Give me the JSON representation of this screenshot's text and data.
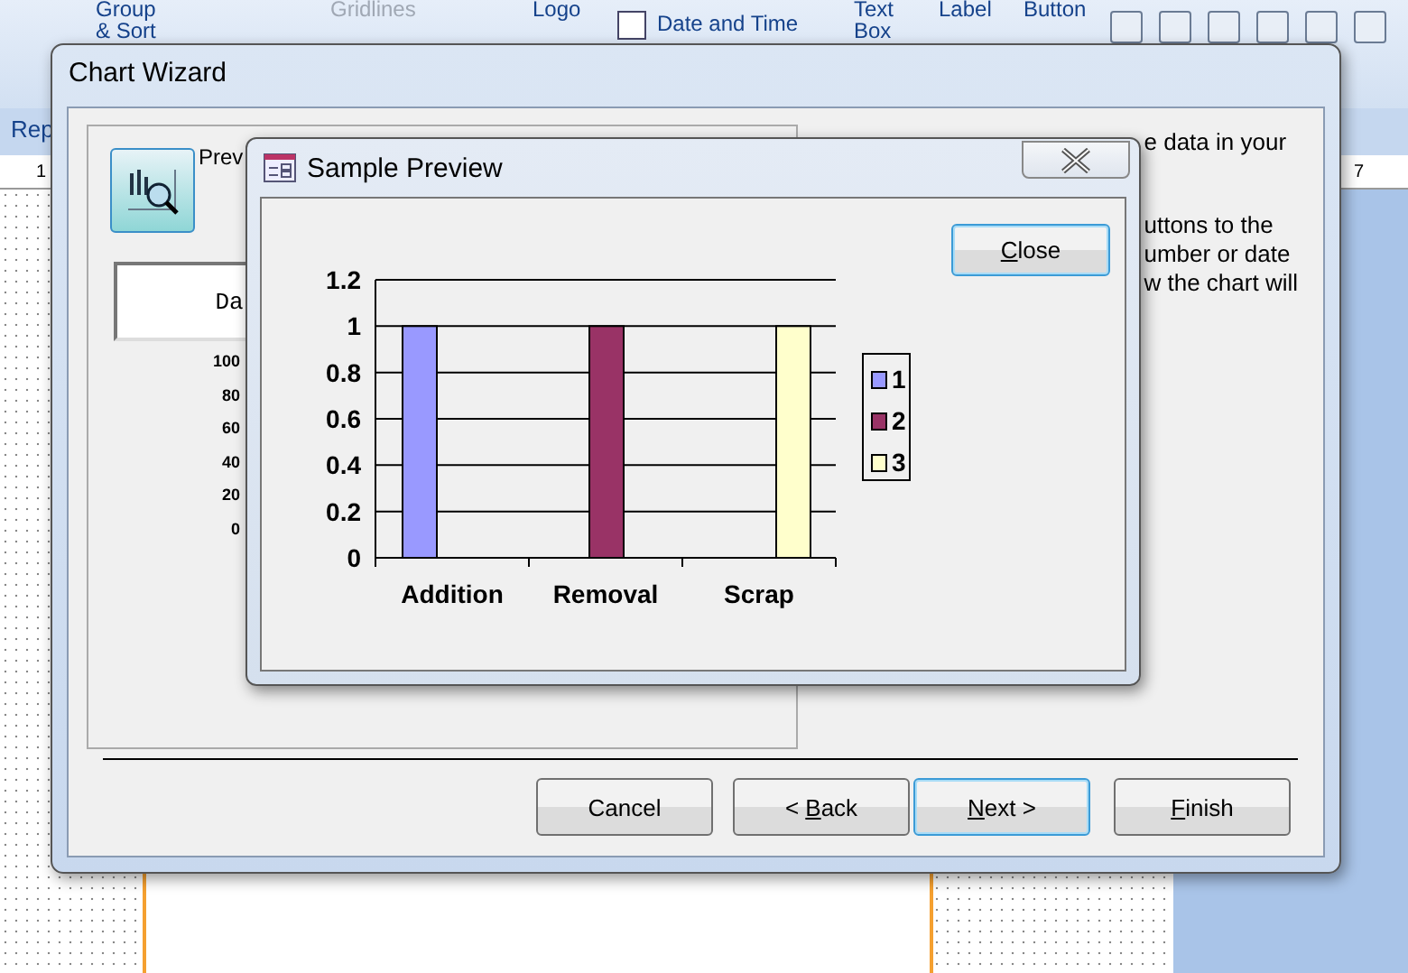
{
  "ribbon": {
    "groups": [
      {
        "lines": [
          "Group",
          "& Sort"
        ],
        "disabled": false
      },
      {
        "lines": [
          "Gridlines"
        ],
        "disabled": true
      },
      {
        "lines": [
          "Logo"
        ],
        "disabled": false
      },
      {
        "lines": [
          "Date and Time"
        ],
        "disabled": false
      },
      {
        "lines": [
          "Text",
          "Box"
        ],
        "disabled": false
      },
      {
        "lines": [
          "Label"
        ],
        "disabled": false
      },
      {
        "lines": [
          "Button"
        ],
        "disabled": false
      }
    ]
  },
  "document_tab": "Rep",
  "ruler_marks": [
    "1",
    "7"
  ],
  "chart_wizard": {
    "title": "Chart Wizard",
    "preview_label": "Prev",
    "chart_title_box": "Da",
    "mini_axis_labels": [
      "100",
      "80",
      "60",
      "40",
      "20",
      "0"
    ],
    "description": [
      [
        "e data in your"
      ],
      [
        "uttons to the",
        "umber or date",
        "w the chart will"
      ]
    ],
    "buttons": [
      {
        "parts": {
          "before": "Cancel"
        },
        "focused": false
      },
      {
        "parts": {
          "before": "< ",
          "key": "B",
          "after": "ack"
        },
        "focused": false
      },
      {
        "parts": {
          "key": "N",
          "after": "ext >"
        },
        "focused": true
      },
      {
        "parts": {
          "key": "F",
          "after": "inish"
        },
        "focused": false
      }
    ]
  },
  "sample_preview": {
    "title": "Sample Preview",
    "close_button": {
      "parts": {
        "key": "C",
        "after": "lose"
      },
      "focused": true
    },
    "chart_data": {
      "type": "bar",
      "categories": [
        "Addition",
        "Removal",
        "Scrap"
      ],
      "series": [
        {
          "name": "1",
          "color": "#9999ff",
          "values": [
            1,
            null,
            null
          ]
        },
        {
          "name": "2",
          "color": "#993366",
          "values": [
            null,
            1,
            null
          ]
        },
        {
          "name": "3",
          "color": "#ffffcc",
          "values": [
            null,
            null,
            1
          ]
        }
      ],
      "grid": true,
      "legend": true,
      "ylim": [
        0,
        1.2
      ],
      "yticks": [
        0,
        0.2,
        0.4,
        0.6,
        0.8,
        1,
        1.2
      ]
    }
  }
}
